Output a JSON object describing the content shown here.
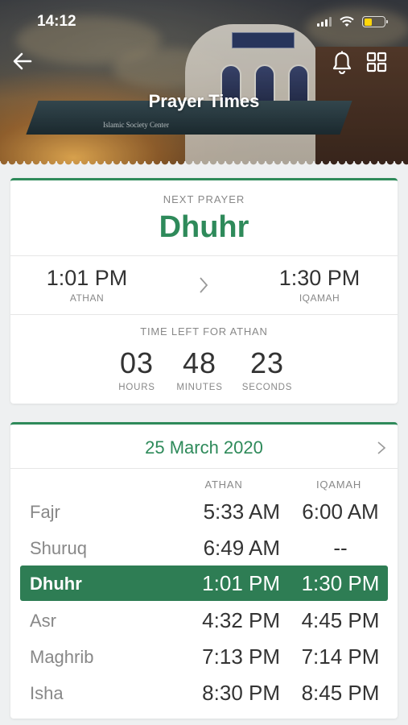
{
  "status_bar": {
    "time": "14:12"
  },
  "header": {
    "title": "Prayer Times",
    "canopy_text": "Islamic Society Center"
  },
  "next_prayer": {
    "label": "NEXT PRAYER",
    "name": "Dhuhr",
    "athan_time": "1:01 PM",
    "athan_label": "ATHAN",
    "iqamah_time": "1:30 PM",
    "iqamah_label": "IQAMAH",
    "time_left_label": "TIME LEFT FOR ATHAN",
    "countdown": [
      {
        "value": "03",
        "unit": "HOURS"
      },
      {
        "value": "48",
        "unit": "MINUTES"
      },
      {
        "value": "23",
        "unit": "SECONDS"
      }
    ]
  },
  "schedule": {
    "date": "25 March 2020",
    "col_athan": "ATHAN",
    "col_iqamah": "IQAMAH",
    "rows": [
      {
        "name": "Fajr",
        "athan": "5:33 AM",
        "iqamah": "6:00 AM"
      },
      {
        "name": "Shuruq",
        "athan": "6:49 AM",
        "iqamah": "--"
      },
      {
        "name": "Dhuhr",
        "athan": "1:01 PM",
        "iqamah": "1:30 PM"
      },
      {
        "name": "Asr",
        "athan": "4:32 PM",
        "iqamah": "4:45 PM"
      },
      {
        "name": "Maghrib",
        "athan": "7:13 PM",
        "iqamah": "7:14 PM"
      },
      {
        "name": "Isha",
        "athan": "8:30 PM",
        "iqamah": "8:45 PM"
      }
    ]
  },
  "colors": {
    "accent": "#2e8a5a",
    "highlight_row": "#2e7d54",
    "battery": "#ffd60a"
  },
  "icons": {
    "back": "arrow-left-icon",
    "notifications": "bell-icon",
    "menu": "grid-icon"
  }
}
